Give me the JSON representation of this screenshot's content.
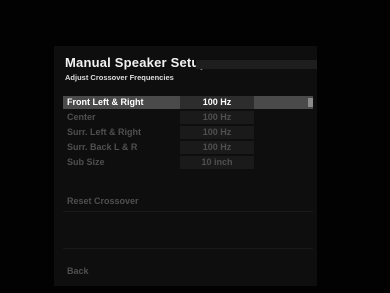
{
  "header": {
    "title": "Manual Speaker Setup",
    "subtitle": "Adjust Crossover Frequencies"
  },
  "settings": [
    {
      "label": "Front Left & Right",
      "value": "100 Hz",
      "selected": true
    },
    {
      "label": "Center",
      "value": "100 Hz",
      "selected": false
    },
    {
      "label": "Surr. Left & Right",
      "value": "100 Hz",
      "selected": false
    },
    {
      "label": "Surr. Back L & R",
      "value": "100 Hz",
      "selected": false
    },
    {
      "label": "Sub Size",
      "value": "10 inch",
      "selected": false
    }
  ],
  "actions": {
    "reset_label": "Reset Crossover",
    "back_label": "Back"
  },
  "colors": {
    "background": "#000000",
    "panel": "#0e0e0e",
    "selected_row": "#4a4a4a",
    "text_active": "#ffffff",
    "text_dim": "#4f4f4f"
  }
}
